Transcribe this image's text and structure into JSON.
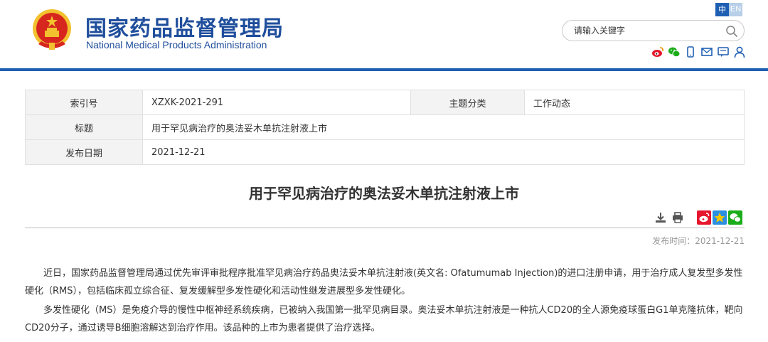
{
  "header": {
    "site_name_cn": "国家药品监督管理局",
    "site_name_en": "National Medical Products Administration",
    "lang_cn": "中",
    "lang_en": "EN",
    "search_placeholder": "请输入关键字"
  },
  "meta": {
    "index_label": "索引号",
    "index_value": "XZXK-2021-291",
    "category_label": "主题分类",
    "category_value": "工作动态",
    "title_label": "标题",
    "title_value": "用于罕见病治疗的奥法妥木单抗注射液上市",
    "date_label": "发布日期",
    "date_value": "2021-12-21"
  },
  "article": {
    "title": "用于罕见病治疗的奥法妥木单抗注射液上市",
    "pub_label": "发布时间：",
    "pub_date": "2021-12-21",
    "paragraphs": [
      "近日，国家药品监督管理局通过优先审评审批程序批准罕见病治疗药品奥法妥木单抗注射液(英文名: Ofatumumab Injection)的进口注册申请，用于治疗成人复发型多发性硬化（RMS），包括临床孤立综合征、复发缓解型多发性硬化和活动性继发进展型多发性硬化。",
      "多发性硬化（MS）是免疫介导的慢性中枢神经系统疾病，已被纳入我国第一批罕见病目录。奥法妥木单抗注射液是一种抗人CD20的全人源免疫球蛋白G1单克隆抗体，靶向CD20分子，通过诱导B细胞溶解达到治疗作用。该品种的上市为患者提供了治疗选择。"
    ]
  },
  "colors": {
    "brand_blue": "#1f4e9c",
    "rule_blue": "#1f5fb3",
    "emblem_red": "#d7261e",
    "emblem_gold": "#f2c12e"
  }
}
